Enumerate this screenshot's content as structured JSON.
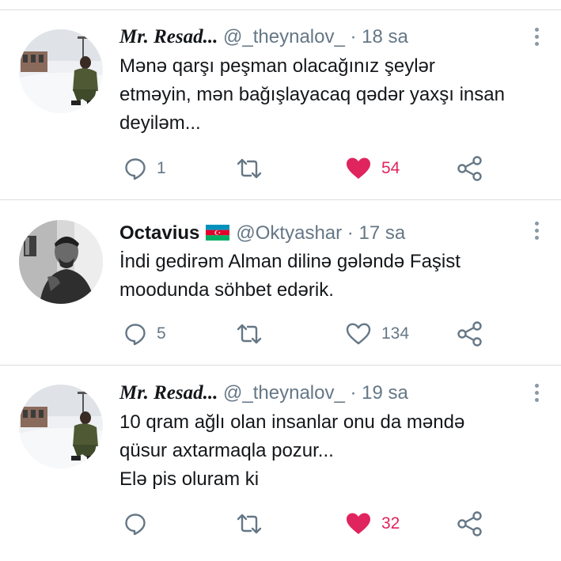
{
  "colors": {
    "like": "#e0245e",
    "muted": "#657786",
    "separator": "#d9dcdf"
  },
  "tweets": [
    {
      "name": "Mr. Resad...",
      "handle": "@_theynalov_",
      "dot": "·",
      "time": "18 sa",
      "lines": [
        "Mənə qarşı peşman olacağınız şeylər",
        "etməyin, mən bağışlayacaq qədər yaxşı insan",
        "deyiləm..."
      ],
      "replies": "1",
      "likes": "54",
      "liked": true
    },
    {
      "name": "Octavius",
      "handle": "@Oktyashar",
      "dot": "·",
      "time": "17 sa",
      "flag": "azerbaijan-flag-icon",
      "lines": [
        "İndi gedirəm Alman dilinə gələndə Faşist",
        "moodunda söhbet edərik."
      ],
      "replies": "5",
      "likes": "134",
      "liked": false
    },
    {
      "name": "Mr. Resad...",
      "handle": "@_theynalov_",
      "dot": "·",
      "time": "19 sa",
      "lines": [
        "10 qram ağlı olan insanlar onu da məndə",
        "qüsur axtarmaqla pozur...",
        "Elə pis oluram ki"
      ],
      "replies": "",
      "likes": "32",
      "liked": true
    }
  ]
}
